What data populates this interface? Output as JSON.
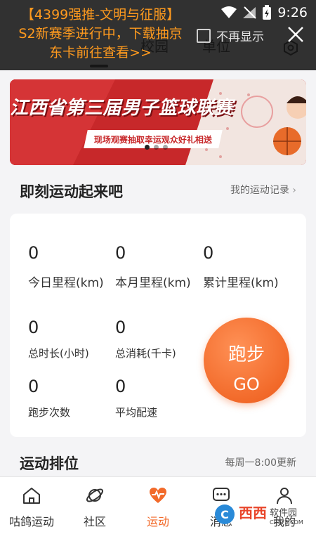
{
  "status_bar": {
    "time": "9:26"
  },
  "notification": {
    "lines": [
      "【4399强推-文明与征服】",
      "S2新赛季进行中，下载抽京",
      "东卡前往查看>>"
    ],
    "checkbox_label": "不再显示"
  },
  "header": {
    "tabs": [
      {
        "label": "校园"
      },
      {
        "label": "单位"
      }
    ]
  },
  "banner": {
    "title": "江西省第三届男子篮球联赛",
    "subtitle": "现场观赛抽取幸运观众好礼相送"
  },
  "section_exercise": {
    "title": "即刻运动起来吧",
    "link": "我的运动记录"
  },
  "stats": {
    "today_km": {
      "value": "0",
      "label": "今日里程(km)"
    },
    "month_km": {
      "value": "0",
      "label": "本月里程(km)"
    },
    "total_km": {
      "value": "0",
      "label": "累计里程(km)"
    },
    "duration": {
      "value": "0",
      "label": "总时长(小时)"
    },
    "calories": {
      "value": "0",
      "label": "总消耗(千卡)"
    },
    "runs": {
      "value": "0",
      "label": "跑步次数"
    },
    "pace": {
      "value": "0",
      "label": "平均配速"
    }
  },
  "run_button": {
    "line1": "跑步",
    "line2": "GO"
  },
  "section_ranking": {
    "title": "运动排位",
    "note": "每周一8:00更新"
  },
  "bottom_nav": {
    "items": [
      {
        "label": "咕鸽运动",
        "icon": "home-icon"
      },
      {
        "label": "社区",
        "icon": "planet-icon"
      },
      {
        "label": "运动",
        "icon": "heartbeat-icon"
      },
      {
        "label": "消息",
        "icon": "message-icon"
      },
      {
        "label": "我的",
        "icon": "user-icon"
      }
    ],
    "active_index": 2
  },
  "watermark": {
    "text": "西西软件园",
    "sub": "CR173.COM"
  },
  "colors": {
    "accent": "#f26a2a",
    "notif_text": "#ff9a1e",
    "banner_red": "#c7282a"
  }
}
